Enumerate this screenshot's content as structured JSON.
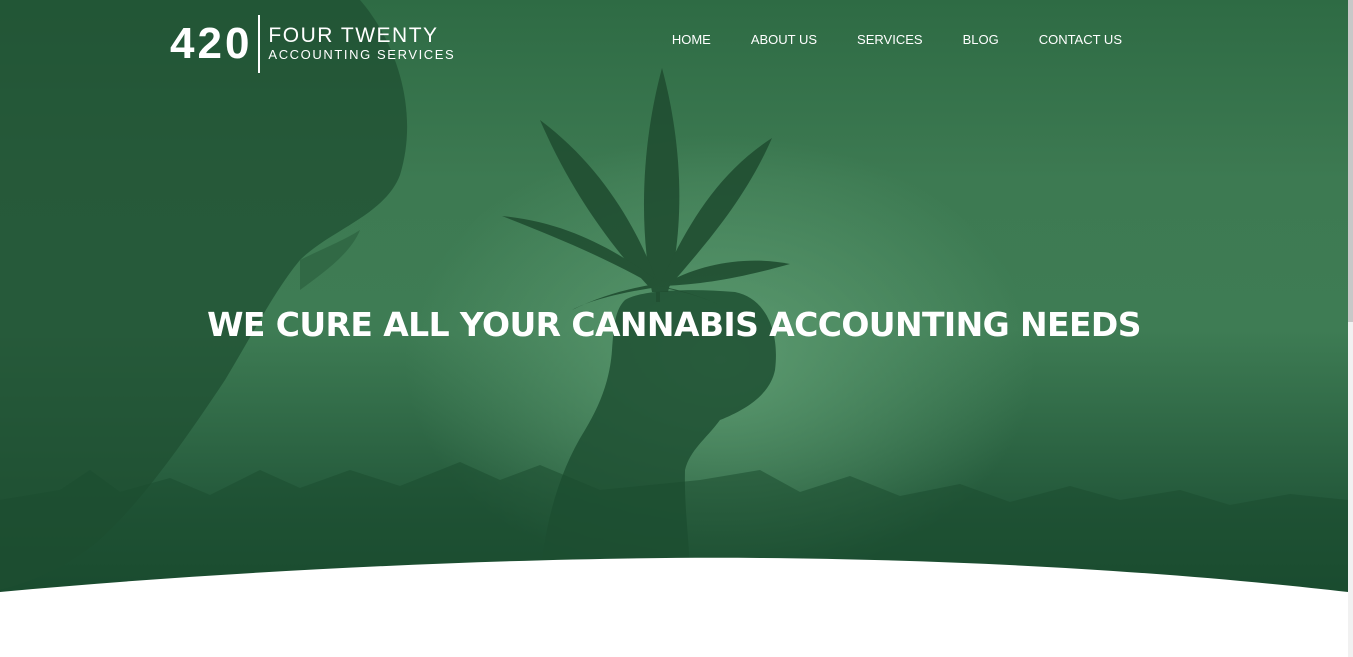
{
  "logo": {
    "number": "420",
    "line1": "FOUR TWENTY",
    "line2": "ACCOUNTING SERVICES"
  },
  "nav": {
    "items": [
      {
        "label": "HOME"
      },
      {
        "label": "ABOUT US"
      },
      {
        "label": "SERVICES"
      },
      {
        "label": "BLOG"
      },
      {
        "label": "CONTACT US"
      }
    ]
  },
  "hero": {
    "headline": "WE CURE ALL YOUR CANNABIS ACCOUNTING NEEDS"
  },
  "colors": {
    "hero_green": "#3e7c54",
    "hero_dark_green": "#184a2e",
    "text": "#ffffff",
    "background": "#ffffff"
  },
  "icons": {
    "hero_image": "cannabis-leaf-silhouette"
  }
}
